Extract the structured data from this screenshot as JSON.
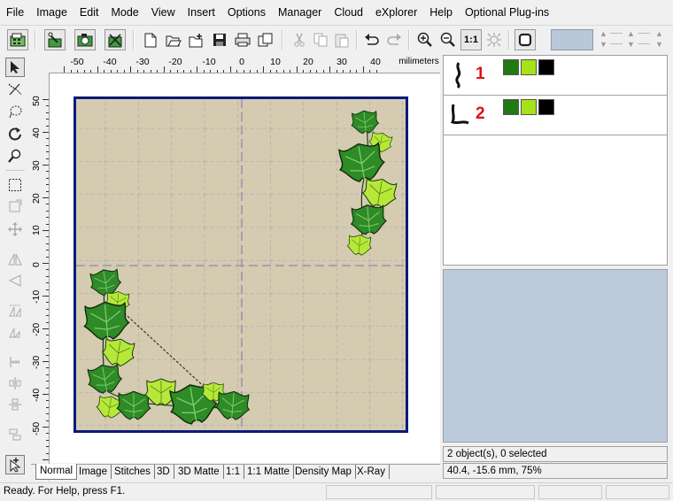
{
  "menu": [
    "File",
    "Image",
    "Edit",
    "Mode",
    "View",
    "Insert",
    "Options",
    "Manager",
    "Cloud",
    "eXplorer",
    "Help",
    "Optional Plug-ins"
  ],
  "toolbar": {
    "icons": [
      "card-reader-icon",
      "wizard-icon",
      "camera-icon",
      "stitch-wizard-icon",
      "new-icon",
      "open-icon",
      "add-icon",
      "save-icon",
      "print-icon",
      "copy-design-icon",
      "cut-icon",
      "copy-icon",
      "paste-icon",
      "undo-icon",
      "redo-icon",
      "zoom-in-icon",
      "zoom-out-icon",
      "actual-size-icon",
      "zoom-fit-icon",
      "hoop-icon"
    ],
    "actual_size_label": "1:1",
    "color_field": "#b8c8d8"
  },
  "left_tools": [
    "select-icon",
    "cut-path-icon",
    "lasso-icon",
    "rotate-icon",
    "zoom-icon",
    "rect-select-icon",
    "resize-icon",
    "move-icon",
    "mirror-h-icon",
    "mirror-v-icon",
    "flip-icon",
    "slant-icon",
    "ruler-icon",
    "center-h-icon",
    "center-v-icon",
    "align-icon",
    "add-tool-icon"
  ],
  "ruler": {
    "h_labels": [
      "-50",
      "-40",
      "-30",
      "-20",
      "-10",
      "0",
      "10",
      "20",
      "30",
      "40"
    ],
    "h_unit": "milimeters",
    "v_labels": [
      "50",
      "40",
      "30",
      "20",
      "10",
      "0",
      "-10",
      "-20",
      "-30",
      "-40",
      "-50"
    ]
  },
  "objects": [
    {
      "number": "1",
      "colors": [
        "#1f7a12",
        "#a6e21a",
        "#000000"
      ]
    },
    {
      "number": "2",
      "colors": [
        "#1f7a12",
        "#a6e21a",
        "#000000"
      ]
    }
  ],
  "selection_status": "2 object(s), 0 selected",
  "coord_status": "40.4, -15.6 mm, 75%",
  "tabs": [
    "Normal",
    "Image",
    "Stitches",
    "3D",
    "3D Matte",
    "1:1",
    "1:1 Matte",
    "Density Map",
    "X-Ray"
  ],
  "active_tab": "Normal",
  "status_text": "Ready. For Help, press F1.",
  "colors": {
    "hoop_border": "#0a1a78",
    "fabric": "#d4cbb0",
    "leaf_dark": "#2f8a28",
    "leaf_light": "#b6e83a",
    "number_red": "#e0101a"
  }
}
